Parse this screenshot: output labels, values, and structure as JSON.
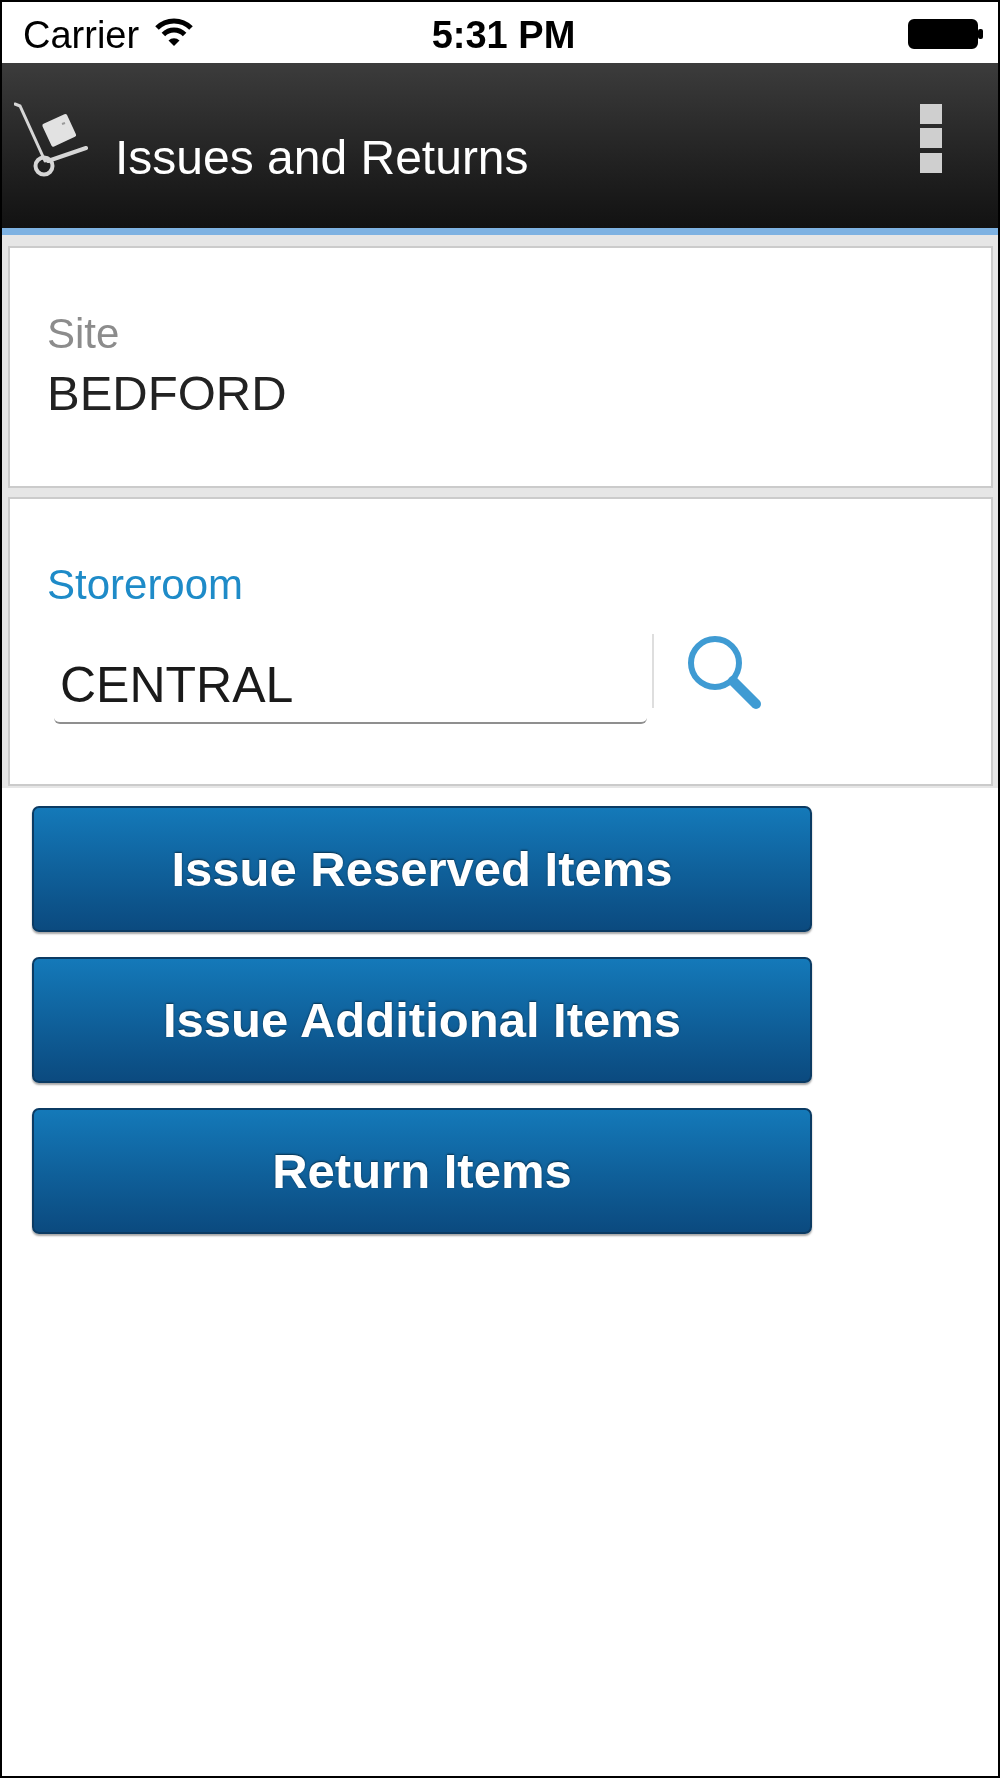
{
  "status_bar": {
    "carrier": "Carrier",
    "time": "5:31 PM"
  },
  "header": {
    "title": "Issues and Returns"
  },
  "fields": [
    {
      "kind": "readonly",
      "label": "Site",
      "value": "BEDFORD"
    },
    {
      "kind": "lookup",
      "label": "Storeroom",
      "value": "CENTRAL"
    }
  ],
  "buttons": [
    {
      "label": "Issue Reserved Items"
    },
    {
      "label": "Issue Additional Items"
    },
    {
      "label": "Return Items"
    }
  ]
}
